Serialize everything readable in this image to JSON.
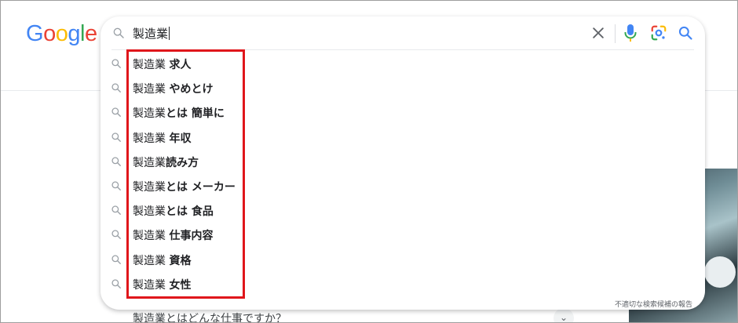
{
  "logo": {
    "letters": [
      "G",
      "o",
      "o",
      "g",
      "l",
      "e"
    ],
    "colors": [
      "#4285F4",
      "#EA4335",
      "#FBBC05",
      "#4285F4",
      "#34A853",
      "#EA4335"
    ]
  },
  "search": {
    "query": "製造業"
  },
  "suggestions": [
    {
      "prefix": "製造業 ",
      "suffix": "求人"
    },
    {
      "prefix": "製造業 ",
      "suffix": "やめとけ"
    },
    {
      "prefix": "製造業",
      "suffix": "とは 簡単に"
    },
    {
      "prefix": "製造業 ",
      "suffix": "年収"
    },
    {
      "prefix": "製造業",
      "suffix": "読み方"
    },
    {
      "prefix": "製造業",
      "suffix": "とは メーカー"
    },
    {
      "prefix": "製造業",
      "suffix": "とは 食品"
    },
    {
      "prefix": "製造業 ",
      "suffix": "仕事内容"
    },
    {
      "prefix": "製造業 ",
      "suffix": "資格"
    },
    {
      "prefix": "製造業 ",
      "suffix": "女性"
    }
  ],
  "report_link": "不適切な検索候補の報告",
  "behind": {
    "question": "製造業とはどんな仕事ですか？",
    "chevron": "⌄"
  },
  "colors": {
    "highlight": "#e0161b",
    "icon_gray": "#5f6368",
    "blue": "#4285F4"
  },
  "icons": [
    "search-icon",
    "clear-icon",
    "mic-icon",
    "lens-icon",
    "search-button-icon"
  ]
}
